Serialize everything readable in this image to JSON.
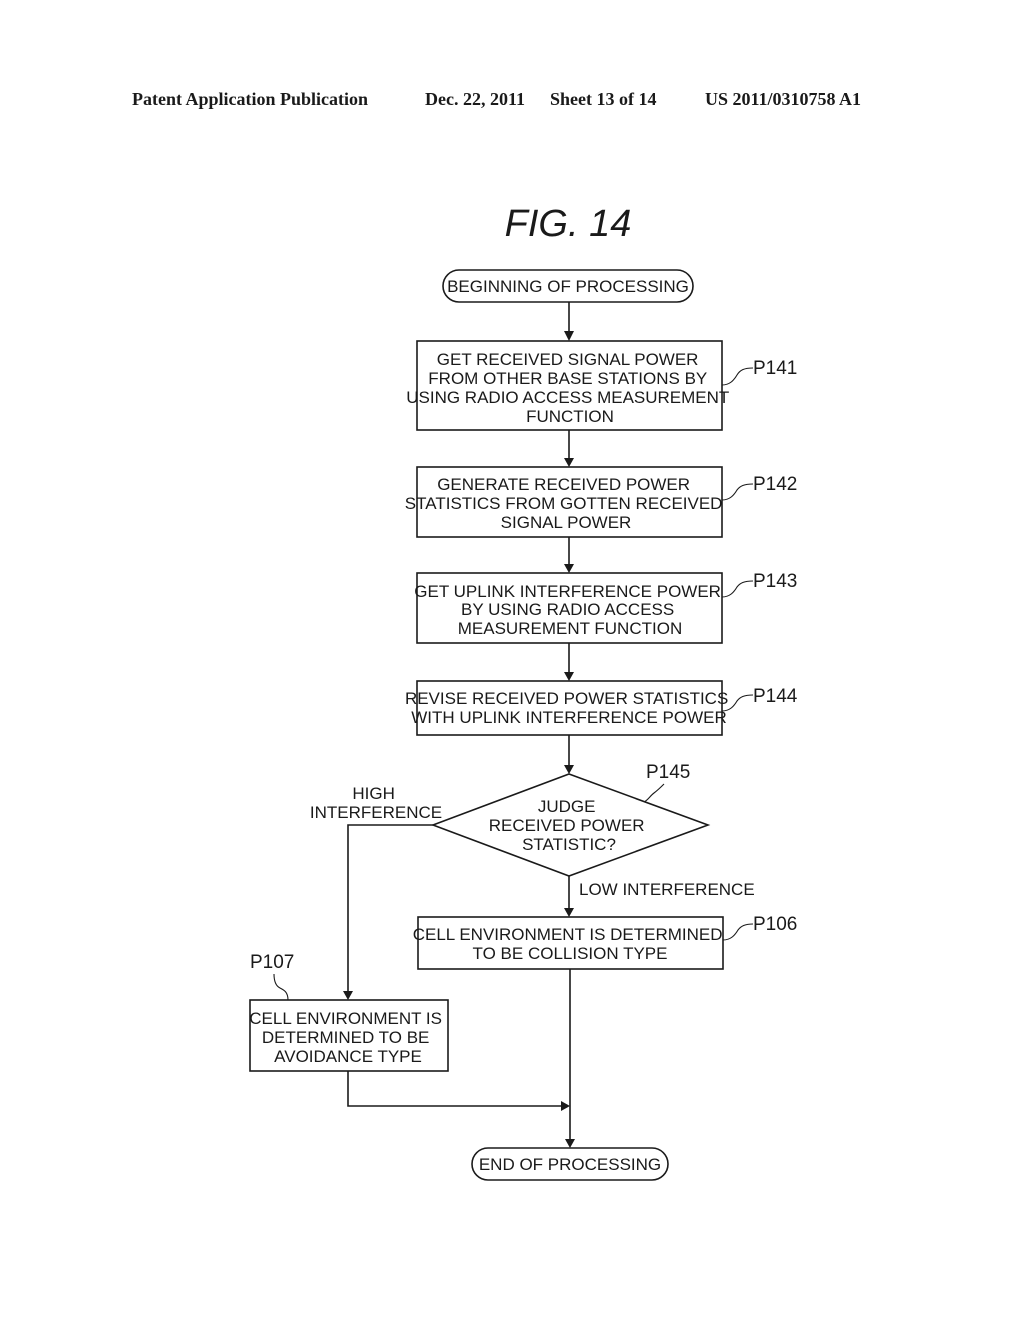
{
  "header": {
    "publication": "Patent Application Publication",
    "date": "Dec. 22, 2011",
    "sheet": "Sheet 13 of 14",
    "number": "US 2011/0310758 A1"
  },
  "figure_title": "FIG.  14",
  "flowchart": {
    "start": "BEGINNING OF PROCESSING",
    "end": "END OF PROCESSING",
    "steps": [
      {
        "id": "P141",
        "lines": [
          "GET RECEIVED SIGNAL POWER",
          "FROM OTHER BASE STATIONS BY",
          "USING RADIO ACCESS MEASUREMENT",
          "FUNCTION"
        ]
      },
      {
        "id": "P142",
        "lines": [
          "GENERATE RECEIVED POWER",
          "STATISTICS FROM GOTTEN RECEIVED",
          "SIGNAL POWER"
        ]
      },
      {
        "id": "P143",
        "lines": [
          "GET UPLINK INTERFERENCE POWER",
          "BY USING RADIO ACCESS",
          "MEASUREMENT FUNCTION"
        ]
      },
      {
        "id": "P144",
        "lines": [
          "REVISE RECEIVED POWER STATISTICS",
          "WITH UPLINK INTERFERENCE POWER"
        ]
      },
      {
        "id": "P106",
        "lines": [
          "CELL ENVIRONMENT IS DETERMINED",
          "TO BE COLLISION TYPE"
        ]
      },
      {
        "id": "P107",
        "lines": [
          "CELL ENVIRONMENT IS",
          "DETERMINED TO BE",
          "AVOIDANCE TYPE"
        ]
      }
    ],
    "decision": {
      "id": "P145",
      "lines": [
        "JUDGE",
        "RECEIVED POWER",
        "STATISTIC?"
      ],
      "branch_high": [
        "HIGH",
        "INTERFERENCE"
      ],
      "branch_low": "LOW INTERFERENCE"
    }
  }
}
